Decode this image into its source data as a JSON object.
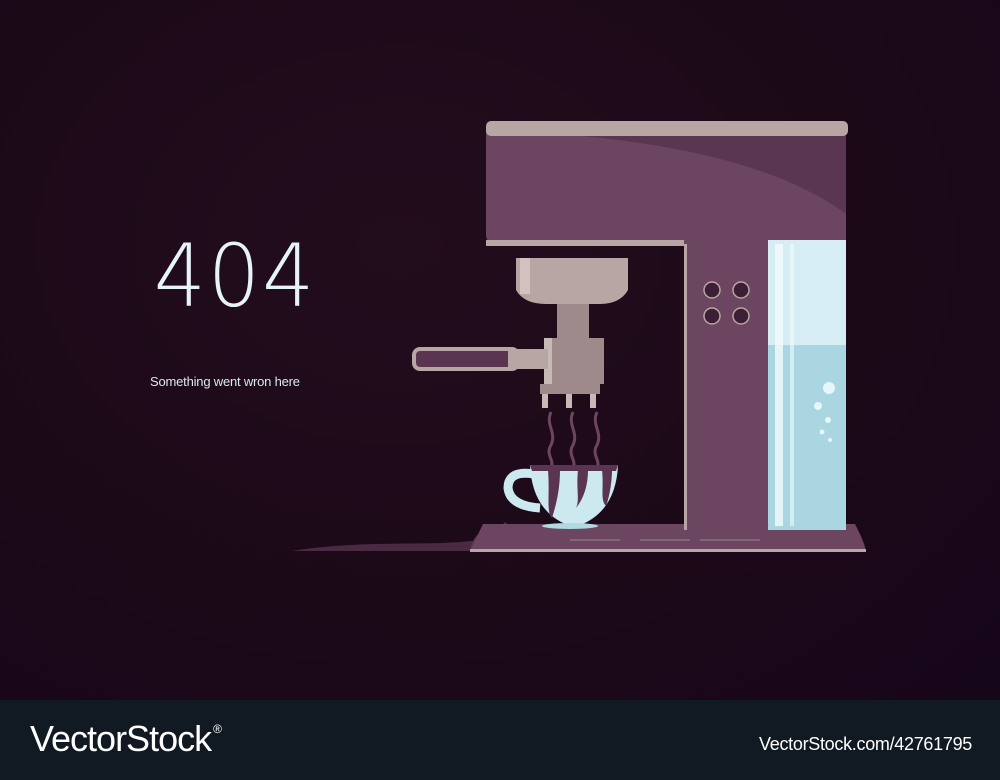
{
  "error": {
    "code": "404",
    "message": "Something went wron here"
  },
  "illustration": {
    "subject": "espresso-machine-with-overflowing-cup",
    "colors": {
      "background": "#1c0918",
      "machine_body": "#6c4660",
      "machine_trim": "#b8a6a4",
      "water_tank": "#c7e6ef",
      "cup": "#cbe9ef",
      "spill": "#5a3450"
    }
  },
  "footer": {
    "brand": "VectorStock",
    "trademark": "®",
    "image_id": "VectorStock.com/42761795"
  }
}
